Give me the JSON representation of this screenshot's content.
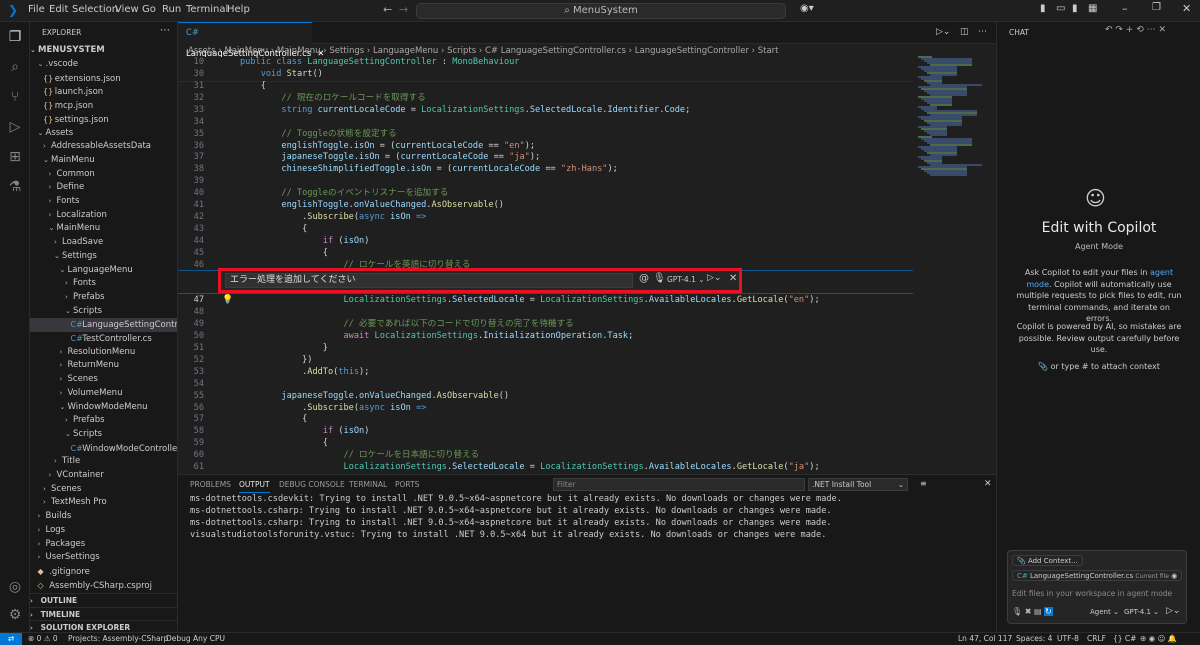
{
  "menu": [
    "File",
    "Edit",
    "Selection",
    "View",
    "Go",
    "Run",
    "Terminal",
    "Help"
  ],
  "search": "MenuSystem",
  "explorer": {
    "header": "EXPLORER",
    "root": "MENUSYSTEM",
    "items": [
      {
        "t": ".vscode",
        "d": 1,
        "e": "open"
      },
      {
        "t": "extensions.json",
        "d": 2,
        "f": "{}"
      },
      {
        "t": "launch.json",
        "d": 2,
        "f": "{}"
      },
      {
        "t": "mcp.json",
        "d": 2,
        "f": "{}"
      },
      {
        "t": "settings.json",
        "d": 2,
        "f": "{}"
      },
      {
        "t": "Assets",
        "d": 1,
        "e": "open"
      },
      {
        "t": "AddressableAssetsData",
        "d": 2,
        "e": "closed"
      },
      {
        "t": "MainMenu",
        "d": 2,
        "e": "open"
      },
      {
        "t": "Common",
        "d": 3,
        "e": "closed"
      },
      {
        "t": "Define",
        "d": 3,
        "e": "closed"
      },
      {
        "t": "Fonts",
        "d": 3,
        "e": "closed"
      },
      {
        "t": "Localization",
        "d": 3,
        "e": "closed"
      },
      {
        "t": "MainMenu",
        "d": 3,
        "e": "open"
      },
      {
        "t": "LoadSave",
        "d": 4,
        "e": "closed"
      },
      {
        "t": "Settings",
        "d": 4,
        "e": "open"
      },
      {
        "t": "LanguageMenu",
        "d": 5,
        "e": "open"
      },
      {
        "t": "Fonts",
        "d": 6,
        "e": "closed"
      },
      {
        "t": "Prefabs",
        "d": 6,
        "e": "closed"
      },
      {
        "t": "Scripts",
        "d": 6,
        "e": "open"
      },
      {
        "t": "LanguageSettingControll...",
        "d": 7,
        "f": "C#",
        "sel": true
      },
      {
        "t": "TestController.cs",
        "d": 7,
        "f": "C#"
      },
      {
        "t": "ResolutionMenu",
        "d": 5,
        "e": "closed"
      },
      {
        "t": "ReturnMenu",
        "d": 5,
        "e": "closed"
      },
      {
        "t": "Scenes",
        "d": 5,
        "e": "closed"
      },
      {
        "t": "VolumeMenu",
        "d": 5,
        "e": "closed"
      },
      {
        "t": "WindowModeMenu",
        "d": 5,
        "e": "open"
      },
      {
        "t": "Prefabs",
        "d": 6,
        "e": "closed"
      },
      {
        "t": "Scripts",
        "d": 6,
        "e": "open"
      },
      {
        "t": "WindowModeController.cs",
        "d": 7,
        "f": "C#"
      },
      {
        "t": "Title",
        "d": 4,
        "e": "closed"
      },
      {
        "t": "VContainer",
        "d": 3,
        "e": "closed"
      },
      {
        "t": "Scenes",
        "d": 2,
        "e": "closed"
      },
      {
        "t": "TextMesh Pro",
        "d": 2,
        "e": "closed"
      },
      {
        "t": "Builds",
        "d": 1,
        "e": "closed"
      },
      {
        "t": "Logs",
        "d": 1,
        "e": "closed"
      },
      {
        "t": "Packages",
        "d": 1,
        "e": "closed"
      },
      {
        "t": "UserSettings",
        "d": 1,
        "e": "closed"
      },
      {
        "t": ".gitignore",
        "d": 1,
        "f": "◆"
      },
      {
        "t": "Assembly-CSharp.csproj",
        "d": 1,
        "f": "◇"
      }
    ],
    "sections": [
      "OUTLINE",
      "TIMELINE",
      "SOLUTION EXPLORER"
    ]
  },
  "editor": {
    "tab": "LanguageSettingController.cs",
    "breadcrumb": "Assets › MainMenu › MainMenu › Settings › LanguageMenu › Scripts › C# LanguageSettingController.cs › LanguageSettingController › Start",
    "sticky": [
      {
        "n": "10",
        "html": "<span class=\"kw\">public class</span> <span class=\"ty\">LanguageSettingController</span> <span class=\"pl\">:</span> <span class=\"ty\">MonoBehaviour</span>",
        "i": 0
      },
      {
        "n": "30",
        "html": "<span class=\"kw\">void</span> <span class=\"fn\">Start</span><span class=\"pl\">()</span>",
        "i": 1
      }
    ],
    "lines": [
      {
        "n": "31",
        "i": 1,
        "html": "<span class=\"pl\">{</span>"
      },
      {
        "n": "32",
        "i": 2,
        "html": "<span class=\"cm\">// 現在のロケールコードを取得する</span>"
      },
      {
        "n": "33",
        "i": 2,
        "html": "<span class=\"kw\">string</span> <span class=\"va\">currentLocaleCode</span> <span class=\"pl\">=</span> <span class=\"ty\">LocalizationSettings</span><span class=\"pl\">.</span><span class=\"va\">SelectedLocale</span><span class=\"pl\">.</span><span class=\"va\">Identifier</span><span class=\"pl\">.</span><span class=\"va\">Code</span><span class=\"pl\">;</span>"
      },
      {
        "n": "34",
        "i": 0,
        "html": ""
      },
      {
        "n": "35",
        "i": 2,
        "html": "<span class=\"cm\">// Toggleの状態を設定する</span>"
      },
      {
        "n": "36",
        "i": 2,
        "html": "<span class=\"va\">englishToggle</span><span class=\"pl\">.</span><span class=\"va\">isOn</span> <span class=\"pl\">= (</span><span class=\"va\">currentLocaleCode</span> <span class=\"pl\">==</span> <span class=\"st\">\"en\"</span><span class=\"pl\">);</span>"
      },
      {
        "n": "37",
        "i": 2,
        "html": "<span class=\"va\">japaneseToggle</span><span class=\"pl\">.</span><span class=\"va\">isOn</span> <span class=\"pl\">= (</span><span class=\"va\">currentLocaleCode</span> <span class=\"pl\">==</span> <span class=\"st\">\"ja\"</span><span class=\"pl\">);</span>"
      },
      {
        "n": "38",
        "i": 2,
        "html": "<span class=\"va\">chineseShimplifiedToggle</span><span class=\"pl\">.</span><span class=\"va\">isOn</span> <span class=\"pl\">= (</span><span class=\"va\">currentLocaleCode</span> <span class=\"pl\">==</span> <span class=\"st\">\"zh-Hans\"</span><span class=\"pl\">);</span>"
      },
      {
        "n": "39",
        "i": 0,
        "html": ""
      },
      {
        "n": "40",
        "i": 2,
        "html": "<span class=\"cm\">// Toggleのイベントリスナーを追加する</span>"
      },
      {
        "n": "41",
        "i": 2,
        "html": "<span class=\"va\">englishToggle</span><span class=\"pl\">.</span><span class=\"va\">onValueChanged</span><span class=\"pl\">.</span><span class=\"fn\">AsObservable</span><span class=\"pl\">()</span>"
      },
      {
        "n": "42",
        "i": 3,
        "html": "<span class=\"pl\">.</span><span class=\"fn\">Subscribe</span><span class=\"pl\">(</span><span class=\"kw\">async</span> <span class=\"va\">isOn</span> <span class=\"kw\">=&gt;</span>"
      },
      {
        "n": "43",
        "i": 3,
        "html": "<span class=\"pl\">{</span>"
      },
      {
        "n": "44",
        "i": 4,
        "html": "<span class=\"ct\">if</span> <span class=\"pl\">(</span><span class=\"va\">isOn</span><span class=\"pl\">)</span>"
      },
      {
        "n": "45",
        "i": 4,
        "html": "<span class=\"pl\">{</span>"
      },
      {
        "n": "46",
        "i": 5,
        "html": "<span class=\"cm\">// ロケールを英語に切り替える</span>"
      }
    ],
    "lines2": [
      {
        "n": "47",
        "i": 5,
        "cur": true,
        "html": "<span class=\"ty\">LocalizationSettings</span><span class=\"pl\">.</span><span class=\"va\">SelectedLocale</span> <span class=\"pl\">=</span> <span class=\"ty\">LocalizationSettings</span><span class=\"pl\">.</span><span class=\"va\">AvailableLocales</span><span class=\"pl\">.</span><span class=\"fn\">GetLocale</span><span class=\"pl\">(</span><span class=\"st\">\"en\"</span><span class=\"pl\">);</span>"
      },
      {
        "n": "48",
        "i": 0,
        "html": ""
      },
      {
        "n": "49",
        "i": 5,
        "html": "<span class=\"cm\">// 必要であれば以下のコードで切り替えの完了を待機する</span>"
      },
      {
        "n": "50",
        "i": 5,
        "html": "<span class=\"ct\">await</span> <span class=\"ty\">LocalizationSettings</span><span class=\"pl\">.</span><span class=\"va\">InitializationOperation</span><span class=\"pl\">.</span><span class=\"va\">Task</span><span class=\"pl\">;</span>"
      },
      {
        "n": "51",
        "i": 4,
        "html": "<span class=\"pl\">}</span>"
      },
      {
        "n": "52",
        "i": 3,
        "html": "<span class=\"pl\">})</span>"
      },
      {
        "n": "53",
        "i": 3,
        "html": "<span class=\"pl\">.</span><span class=\"fn\">AddTo</span><span class=\"pl\">(</span><span class=\"kw\">this</span><span class=\"pl\">);</span>"
      },
      {
        "n": "54",
        "i": 0,
        "html": ""
      },
      {
        "n": "55",
        "i": 2,
        "html": "<span class=\"va\">japaneseToggle</span><span class=\"pl\">.</span><span class=\"va\">onValueChanged</span><span class=\"pl\">.</span><span class=\"fn\">AsObservable</span><span class=\"pl\">()</span>"
      },
      {
        "n": "56",
        "i": 3,
        "html": "<span class=\"pl\">.</span><span class=\"fn\">Subscribe</span><span class=\"pl\">(</span><span class=\"kw\">async</span> <span class=\"va\">isOn</span> <span class=\"kw\">=&gt;</span>"
      },
      {
        "n": "57",
        "i": 3,
        "html": "<span class=\"pl\">{</span>"
      },
      {
        "n": "58",
        "i": 4,
        "html": "<span class=\"ct\">if</span> <span class=\"pl\">(</span><span class=\"va\">isOn</span><span class=\"pl\">)</span>"
      },
      {
        "n": "59",
        "i": 4,
        "html": "<span class=\"pl\">{</span>"
      },
      {
        "n": "60",
        "i": 5,
        "html": "<span class=\"cm\">// ロケールを日本語に切り替える</span>"
      },
      {
        "n": "61",
        "i": 5,
        "html": "<span class=\"ty\">LocalizationSettings</span><span class=\"pl\">.</span><span class=\"va\">SelectedLocale</span> <span class=\"pl\">=</span> <span class=\"ty\">LocalizationSettings</span><span class=\"pl\">.</span><span class=\"va\">AvailableLocales</span><span class=\"pl\">.</span><span class=\"fn\">GetLocale</span><span class=\"pl\">(</span><span class=\"st\">\"ja\"</span><span class=\"pl\">);</span>"
      }
    ]
  },
  "inline_chat": {
    "value": "エラー処理を追加してください",
    "at": "@",
    "model": "GPT-4.1",
    "send": "▷"
  },
  "panel": {
    "tabs": [
      "PROBLEMS",
      "OUTPUT",
      "DEBUG CONSOLE",
      "TERMINAL",
      "PORTS"
    ],
    "active": "OUTPUT",
    "filter_placeholder": "Filter",
    "channel": ".NET Install Tool",
    "output": [
      "ms-dotnettools.csdevkit: Trying to install .NET 9.0.5~x64~aspnetcore but it already exists. No downloads or changes were made.",
      "ms-dotnettools.csharp: Trying to install .NET 9.0.5~x64~aspnetcore but it already exists. No downloads or changes were made.",
      "ms-dotnettools.csharp: Trying to install .NET 9.0.5~x64~aspnetcore but it already exists. No downloads or changes were made.",
      "visualstudiotoolsforunity.vstuc: Trying to install .NET 9.0.5~x64 but it already exists. No downloads or changes were made."
    ]
  },
  "chat": {
    "header": "CHAT",
    "title": "Edit with Copilot",
    "subtitle": "Agent Mode",
    "desc1a": "Ask Copilot to edit your files in ",
    "desc1link": "agent mode",
    "desc1b": ". Copilot will automatically use multiple requests to pick files to edit, run terminal commands, and iterate on errors.",
    "desc2": "Copilot is powered by AI, so mistakes are possible. Review output carefully before use.",
    "attach_hint": "or type # to attach context",
    "add_context": "Add Context...",
    "file_chip": "LanguageSettingController.cs",
    "file_chip_tag": "Current file",
    "input_placeholder": "Edit files in your workspace in agent mode",
    "mode": "Agent",
    "model": "GPT-4.1"
  },
  "status": {
    "errors": "⊗ 0 ⚠ 0",
    "projects": "Projects: Assembly-CSharp",
    "debug": "Debug Any CPU",
    "position": "Ln 47, Col 117",
    "spaces": "Spaces: 4",
    "encoding": "UTF-8",
    "eol": "CRLF",
    "lang": "{} C#"
  }
}
